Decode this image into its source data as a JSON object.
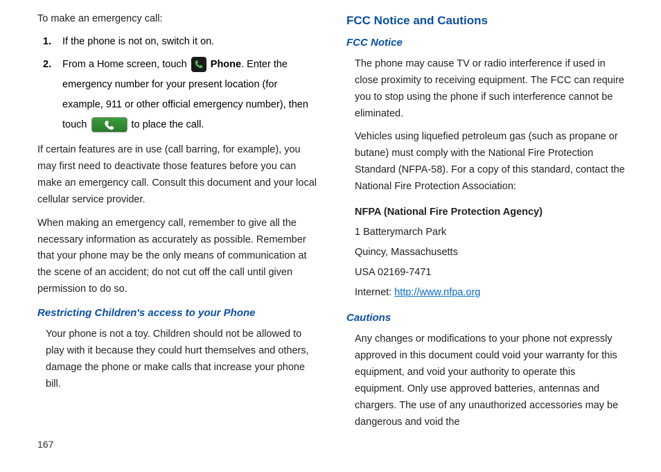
{
  "page_number": "167",
  "left": {
    "intro": "To make an emergency call:",
    "steps": [
      {
        "num": "1.",
        "pre": "If the phone is not on, switch it on."
      },
      {
        "num": "2.",
        "pre": "From a Home screen, touch ",
        "bold1": "Phone",
        "mid": ". Enter the emergency number for your present location (for example, 911 or other official emergency number), then touch ",
        "post": " to place the call."
      }
    ],
    "p1": "If certain features are in use (call barring, for example), you may first need to deactivate those features before you can make an emergency call. Consult this document and your local cellular service provider.",
    "p2": "When making an emergency call, remember to give all the necessary information as accurately as possible. Remember that your phone may be the only means of communication at the scene of an accident; do not cut off the call until given permission to do so.",
    "h_restrict": "Restricting Children's access to your Phone",
    "p_restrict": "Your phone is not a toy. Children should not be allowed to play with it because they could hurt themselves and others, damage the phone or make calls that increase your phone bill."
  },
  "right": {
    "h_fcc_main": "FCC Notice and Cautions",
    "h_fcc": "FCC Notice",
    "p_fcc1": "The phone may cause TV or radio interference if used in close proximity to receiving equipment. The FCC can require you to stop using the phone if such interference cannot be eliminated.",
    "p_fcc2": "Vehicles using liquefied petroleum gas (such as propane or butane) must comply with the National Fire Protection Standard (NFPA-58). For a copy of this standard, contact the National Fire Protection Association:",
    "addr": {
      "head": "NFPA (National Fire Protection Agency)",
      "l1": "1 Batterymarch Park",
      "l2": "Quincy, Massachusetts",
      "l3": "USA  02169-7471",
      "internet_label": "Internet: ",
      "internet_link": "http://www.nfpa.org"
    },
    "h_cautions": "Cautions",
    "p_cautions": "Any changes or modifications to your phone not expressly approved in this document could void your warranty for this equipment, and void your authority to operate this equipment. Only use approved batteries, antennas and chargers. The use of any unauthorized accessories may be dangerous and void the"
  }
}
